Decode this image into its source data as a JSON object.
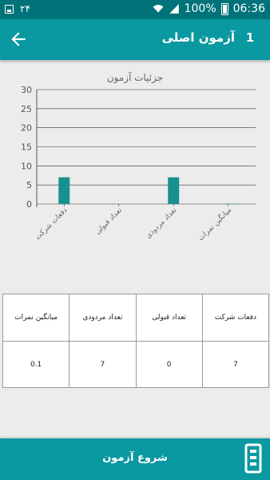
{
  "status_bar": {
    "time": "06:36",
    "battery": "100%",
    "notification": "۲۴",
    "icons": [
      "image-icon",
      "wifi-icon",
      "signal-icon",
      "battery-icon"
    ]
  },
  "app_bar": {
    "title": "آزمون اصلی",
    "number": "1",
    "back_icon": "arrow-back-icon"
  },
  "chart_data": {
    "type": "bar",
    "title": "جزئیات آزمون",
    "categories": [
      "دفعات شرکت",
      "تعداد قبولی",
      "تعداد مردودی",
      "میانگین نمرات"
    ],
    "values": [
      7,
      0,
      7,
      0.1
    ],
    "yticks": [
      "0",
      "5",
      "10",
      "15",
      "20",
      "25",
      "30"
    ],
    "ylim": [
      0,
      30
    ],
    "grid": true,
    "bar_color": "#17918f"
  },
  "table": {
    "headers": [
      "دفعات شرکت",
      "تعداد قبولی",
      "تعداد مردودی",
      "میانگین نمرات"
    ],
    "values": [
      "7",
      "0",
      "7",
      "0.1"
    ]
  },
  "start_button": {
    "label": "شروع آزمون"
  },
  "colors": {
    "primary": "#0a98a1",
    "status_bar": "#00737a",
    "background": "#ececec"
  }
}
